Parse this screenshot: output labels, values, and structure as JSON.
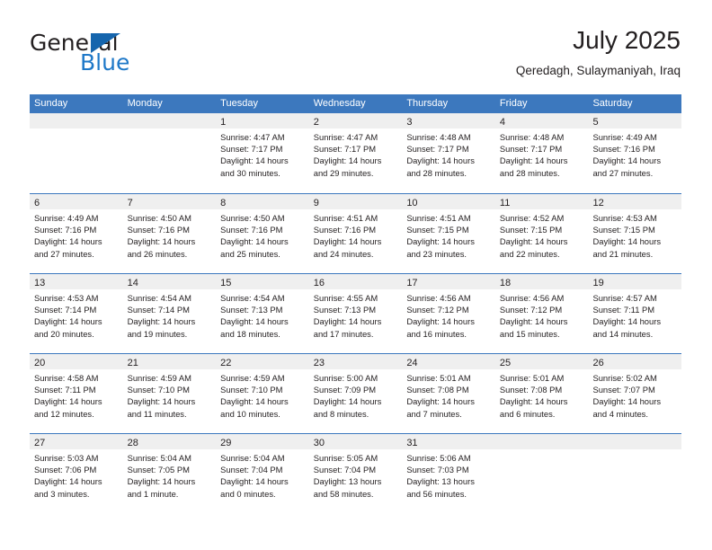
{
  "brand": {
    "name_dark": "General",
    "name_blue": "Blue",
    "logo_icon": "blue-flag-triangle"
  },
  "header": {
    "title": "July 2025",
    "subtitle": "Qeredagh, Sulaymaniyah, Iraq"
  },
  "colors": {
    "header_blue": "#3c78be",
    "logo_blue": "#1e78c8",
    "day_band_gray": "#efefef",
    "text": "#231f20"
  },
  "weekdays": [
    "Sunday",
    "Monday",
    "Tuesday",
    "Wednesday",
    "Thursday",
    "Friday",
    "Saturday"
  ],
  "weeks": [
    [
      {
        "day": "",
        "sunrise": "",
        "sunset": "",
        "daylight": ""
      },
      {
        "day": "",
        "sunrise": "",
        "sunset": "",
        "daylight": ""
      },
      {
        "day": "1",
        "sunrise": "Sunrise: 4:47 AM",
        "sunset": "Sunset: 7:17 PM",
        "daylight": "Daylight: 14 hours and 30 minutes."
      },
      {
        "day": "2",
        "sunrise": "Sunrise: 4:47 AM",
        "sunset": "Sunset: 7:17 PM",
        "daylight": "Daylight: 14 hours and 29 minutes."
      },
      {
        "day": "3",
        "sunrise": "Sunrise: 4:48 AM",
        "sunset": "Sunset: 7:17 PM",
        "daylight": "Daylight: 14 hours and 28 minutes."
      },
      {
        "day": "4",
        "sunrise": "Sunrise: 4:48 AM",
        "sunset": "Sunset: 7:17 PM",
        "daylight": "Daylight: 14 hours and 28 minutes."
      },
      {
        "day": "5",
        "sunrise": "Sunrise: 4:49 AM",
        "sunset": "Sunset: 7:16 PM",
        "daylight": "Daylight: 14 hours and 27 minutes."
      }
    ],
    [
      {
        "day": "6",
        "sunrise": "Sunrise: 4:49 AM",
        "sunset": "Sunset: 7:16 PM",
        "daylight": "Daylight: 14 hours and 27 minutes."
      },
      {
        "day": "7",
        "sunrise": "Sunrise: 4:50 AM",
        "sunset": "Sunset: 7:16 PM",
        "daylight": "Daylight: 14 hours and 26 minutes."
      },
      {
        "day": "8",
        "sunrise": "Sunrise: 4:50 AM",
        "sunset": "Sunset: 7:16 PM",
        "daylight": "Daylight: 14 hours and 25 minutes."
      },
      {
        "day": "9",
        "sunrise": "Sunrise: 4:51 AM",
        "sunset": "Sunset: 7:16 PM",
        "daylight": "Daylight: 14 hours and 24 minutes."
      },
      {
        "day": "10",
        "sunrise": "Sunrise: 4:51 AM",
        "sunset": "Sunset: 7:15 PM",
        "daylight": "Daylight: 14 hours and 23 minutes."
      },
      {
        "day": "11",
        "sunrise": "Sunrise: 4:52 AM",
        "sunset": "Sunset: 7:15 PM",
        "daylight": "Daylight: 14 hours and 22 minutes."
      },
      {
        "day": "12",
        "sunrise": "Sunrise: 4:53 AM",
        "sunset": "Sunset: 7:15 PM",
        "daylight": "Daylight: 14 hours and 21 minutes."
      }
    ],
    [
      {
        "day": "13",
        "sunrise": "Sunrise: 4:53 AM",
        "sunset": "Sunset: 7:14 PM",
        "daylight": "Daylight: 14 hours and 20 minutes."
      },
      {
        "day": "14",
        "sunrise": "Sunrise: 4:54 AM",
        "sunset": "Sunset: 7:14 PM",
        "daylight": "Daylight: 14 hours and 19 minutes."
      },
      {
        "day": "15",
        "sunrise": "Sunrise: 4:54 AM",
        "sunset": "Sunset: 7:13 PM",
        "daylight": "Daylight: 14 hours and 18 minutes."
      },
      {
        "day": "16",
        "sunrise": "Sunrise: 4:55 AM",
        "sunset": "Sunset: 7:13 PM",
        "daylight": "Daylight: 14 hours and 17 minutes."
      },
      {
        "day": "17",
        "sunrise": "Sunrise: 4:56 AM",
        "sunset": "Sunset: 7:12 PM",
        "daylight": "Daylight: 14 hours and 16 minutes."
      },
      {
        "day": "18",
        "sunrise": "Sunrise: 4:56 AM",
        "sunset": "Sunset: 7:12 PM",
        "daylight": "Daylight: 14 hours and 15 minutes."
      },
      {
        "day": "19",
        "sunrise": "Sunrise: 4:57 AM",
        "sunset": "Sunset: 7:11 PM",
        "daylight": "Daylight: 14 hours and 14 minutes."
      }
    ],
    [
      {
        "day": "20",
        "sunrise": "Sunrise: 4:58 AM",
        "sunset": "Sunset: 7:11 PM",
        "daylight": "Daylight: 14 hours and 12 minutes."
      },
      {
        "day": "21",
        "sunrise": "Sunrise: 4:59 AM",
        "sunset": "Sunset: 7:10 PM",
        "daylight": "Daylight: 14 hours and 11 minutes."
      },
      {
        "day": "22",
        "sunrise": "Sunrise: 4:59 AM",
        "sunset": "Sunset: 7:10 PM",
        "daylight": "Daylight: 14 hours and 10 minutes."
      },
      {
        "day": "23",
        "sunrise": "Sunrise: 5:00 AM",
        "sunset": "Sunset: 7:09 PM",
        "daylight": "Daylight: 14 hours and 8 minutes."
      },
      {
        "day": "24",
        "sunrise": "Sunrise: 5:01 AM",
        "sunset": "Sunset: 7:08 PM",
        "daylight": "Daylight: 14 hours and 7 minutes."
      },
      {
        "day": "25",
        "sunrise": "Sunrise: 5:01 AM",
        "sunset": "Sunset: 7:08 PM",
        "daylight": "Daylight: 14 hours and 6 minutes."
      },
      {
        "day": "26",
        "sunrise": "Sunrise: 5:02 AM",
        "sunset": "Sunset: 7:07 PM",
        "daylight": "Daylight: 14 hours and 4 minutes."
      }
    ],
    [
      {
        "day": "27",
        "sunrise": "Sunrise: 5:03 AM",
        "sunset": "Sunset: 7:06 PM",
        "daylight": "Daylight: 14 hours and 3 minutes."
      },
      {
        "day": "28",
        "sunrise": "Sunrise: 5:04 AM",
        "sunset": "Sunset: 7:05 PM",
        "daylight": "Daylight: 14 hours and 1 minute."
      },
      {
        "day": "29",
        "sunrise": "Sunrise: 5:04 AM",
        "sunset": "Sunset: 7:04 PM",
        "daylight": "Daylight: 14 hours and 0 minutes."
      },
      {
        "day": "30",
        "sunrise": "Sunrise: 5:05 AM",
        "sunset": "Sunset: 7:04 PM",
        "daylight": "Daylight: 13 hours and 58 minutes."
      },
      {
        "day": "31",
        "sunrise": "Sunrise: 5:06 AM",
        "sunset": "Sunset: 7:03 PM",
        "daylight": "Daylight: 13 hours and 56 minutes."
      },
      {
        "day": "",
        "sunrise": "",
        "sunset": "",
        "daylight": ""
      },
      {
        "day": "",
        "sunrise": "",
        "sunset": "",
        "daylight": ""
      }
    ]
  ]
}
